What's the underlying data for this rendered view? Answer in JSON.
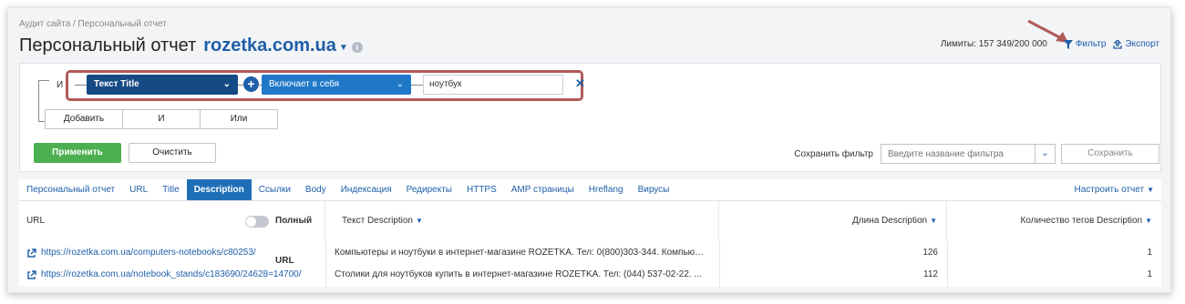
{
  "breadcrumb": "Аудит сайта / Персональный отчет",
  "title": "Персональный отчет",
  "domain": "rozetka.com.ua",
  "limits": "Лимиты: 157 349/200 000",
  "filter_label": "Фильтр",
  "export_label": "Экспорт",
  "filter": {
    "logic_label": "И",
    "field": "Текст Title",
    "operator": "Включает в себя",
    "value": "ноутбук",
    "add_buttons": [
      "Добавить",
      "И",
      "Или"
    ]
  },
  "apply_label": "Применить",
  "clear_label": "Очистить",
  "save": {
    "label": "Сохранить фильтр",
    "placeholder": "Введите название фильтра",
    "button": "Сохранить"
  },
  "tabs": [
    "Персональный отчет",
    "URL",
    "Title",
    "Description",
    "Ссылки",
    "Body",
    "Индексация",
    "Редиректы",
    "HTTPS",
    "AMP страницы",
    "Hreflang",
    "Вирусы"
  ],
  "active_tab": "Description",
  "configure_label": "Настроить отчет",
  "table": {
    "headers": {
      "url": "URL",
      "full_url": "Полный URL",
      "text": "Текст Description",
      "length": "Длина Description",
      "count": "Количество тегов Description"
    },
    "rows": [
      {
        "url": "https://rozetka.com.ua/computers-notebooks/c80253/",
        "text": "Компьютеры и ноутбуки в интернет-магазине ROZETKA. Тел: 0(800)303-344. Компьютер...",
        "length": "126",
        "count": "1"
      },
      {
        "url": "https://rozetka.com.ua/notebook_stands/c183690/24628=14700/",
        "text": "Столики для ноутбуков купить в интернет-магазине ROZETKA. Тел: (044) 537-02-22. ...",
        "length": "112",
        "count": "1"
      }
    ]
  },
  "colors": {
    "accent": "#1e5fa8",
    "apply": "#4caf50",
    "highlight": "#b05a5a"
  }
}
